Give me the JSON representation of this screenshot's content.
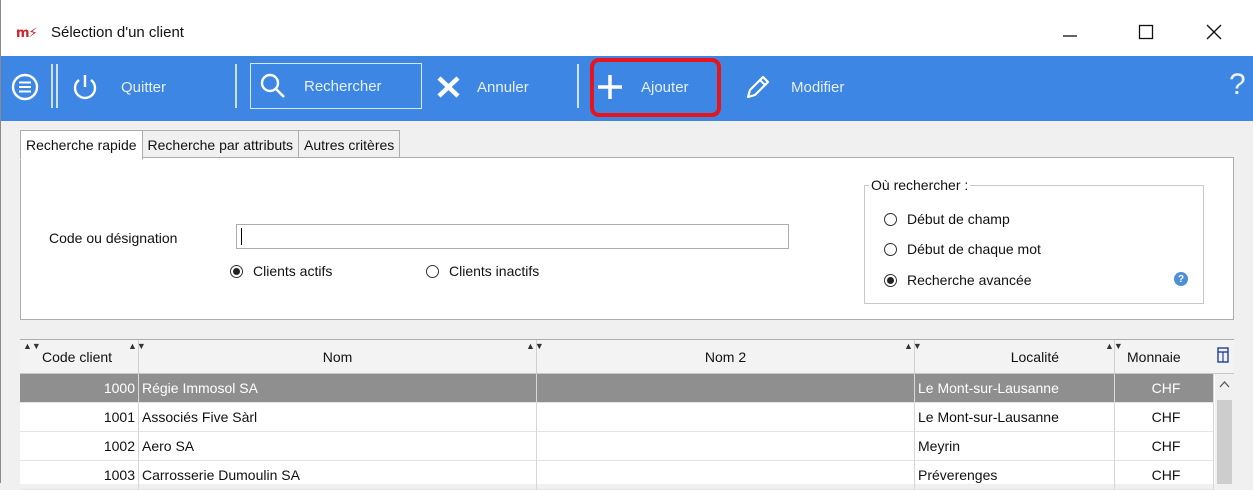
{
  "window": {
    "logo": "m⚡",
    "title": "Sélection d'un client"
  },
  "toolbar": {
    "quit_label": "Quitter",
    "search_label": "Rechercher",
    "cancel_label": "Annuler",
    "add_label": "Ajouter",
    "edit_label": "Modifier",
    "help_label": "?"
  },
  "tabs": [
    "Recherche rapide",
    "Recherche par attributs",
    "Autres critères"
  ],
  "search": {
    "code_label": "Code ou désignation",
    "code_value": "",
    "status_options": [
      {
        "label": "Clients actifs",
        "checked": true
      },
      {
        "label": "Clients inactifs",
        "checked": false
      }
    ],
    "where": {
      "title": "Où rechercher :",
      "options": [
        {
          "label": "Début de champ",
          "checked": false
        },
        {
          "label": "Début de chaque mot",
          "checked": false
        },
        {
          "label": "Recherche avancée",
          "checked": true
        }
      ]
    }
  },
  "grid": {
    "columns": [
      "Code client",
      "Nom",
      "Nom 2",
      "Localité",
      "Monnaie"
    ],
    "rows": [
      {
        "code": "1000",
        "nom": "Régie Immosol SA",
        "nom2": "",
        "localite": "Le Mont-sur-Lausanne",
        "monnaie": "CHF",
        "selected": true
      },
      {
        "code": "1001",
        "nom": "Associés Five Sàrl",
        "nom2": "",
        "localite": "Le Mont-sur-Lausanne",
        "monnaie": "CHF",
        "selected": false
      },
      {
        "code": "1002",
        "nom": "Aero SA",
        "nom2": "",
        "localite": "Meyrin",
        "monnaie": "CHF",
        "selected": false
      },
      {
        "code": "1003",
        "nom": "Carrosserie Dumoulin SA",
        "nom2": "",
        "localite": "Préverenges",
        "monnaie": "CHF",
        "selected": false
      }
    ]
  },
  "colors": {
    "toolbar": "#3d86e4",
    "highlight": "#e8141b",
    "selected_row": "#8f8f8f"
  }
}
